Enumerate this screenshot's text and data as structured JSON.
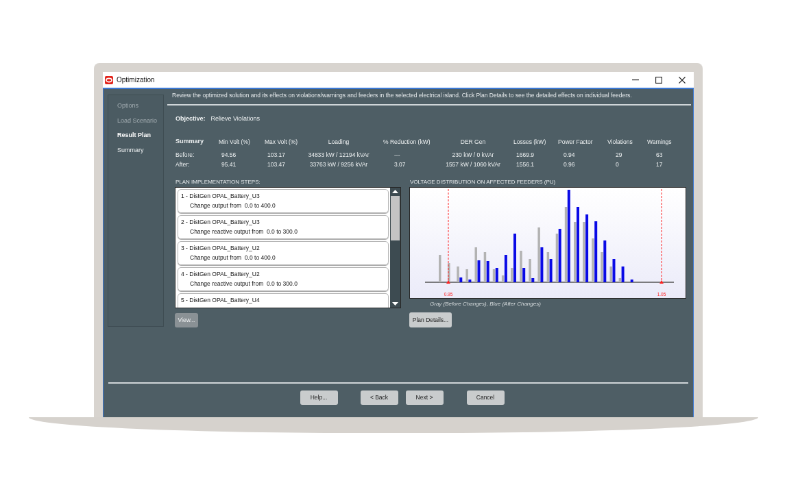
{
  "window": {
    "title": "Optimization"
  },
  "nav": [
    {
      "label": "Options",
      "selected": false,
      "disabled": true
    },
    {
      "label": "Load Scenario",
      "selected": false,
      "disabled": true
    },
    {
      "label": "Result Plan",
      "selected": true,
      "disabled": false
    },
    {
      "label": "Summary",
      "selected": false,
      "disabled": false
    }
  ],
  "instructions": "Review the optimized solution and its effects on violations/warnings and feeders in the selected electrical island. Click Plan Details to see the detailed effects on individual feeders.",
  "objective": {
    "label": "Objective:",
    "value": "Relieve Violations"
  },
  "summary": {
    "columns": [
      "Summary",
      "Min Volt (%)",
      "Max Volt (%)",
      "Loading",
      "% Reduction (kW)",
      "DER Gen",
      "Losses (kW)",
      "Power Factor",
      "Violations",
      "Warnings"
    ],
    "rows": [
      [
        "Before:",
        "94.56",
        "103.17",
        "34833 kW / 12194 kVAr",
        "---",
        "230 kW / 0 kVAr",
        "1669.9",
        "0.94",
        "29",
        "63"
      ],
      [
        "After:",
        "95.41",
        "103.47",
        "33763 kW / 9256 kVAr",
        "3.07",
        "1557 kW / 1060 kVAr",
        "1556.1",
        "0.96",
        "0",
        "17"
      ]
    ]
  },
  "steps": {
    "title": "PLAN IMPLEMENTATION STEPS:",
    "items": [
      {
        "title": "1 - DistGen OPAL_Battery_U3",
        "detail": "Change output from  0.0 to 400.0"
      },
      {
        "title": "2 - DistGen OPAL_Battery_U3",
        "detail": "Change reactive output from  0.0 to 300.0"
      },
      {
        "title": "3 - DistGen OPAL_Battery_U2",
        "detail": "Change output from  0.0 to 400.0"
      },
      {
        "title": "4 - DistGen OPAL_Battery_U2",
        "detail": "Change reactive output from  0.0 to 300.0"
      },
      {
        "title": "5 - DistGen OPAL_Battery_U4"
      }
    ],
    "view_button": {
      "label": "View...",
      "disabled": true
    }
  },
  "chart": {
    "title": "VOLTAGE DISTRIBUTION ON AFFECTED FEEDERS (PU)",
    "limit_labels": [
      "0.95",
      "1.05"
    ],
    "legend": "Gray (Before Changes), Blue (After Changes)",
    "details_button": "Plan Details..."
  },
  "buttons": [
    "Help...",
    "< Back",
    "Next >",
    "Cancel"
  ]
}
